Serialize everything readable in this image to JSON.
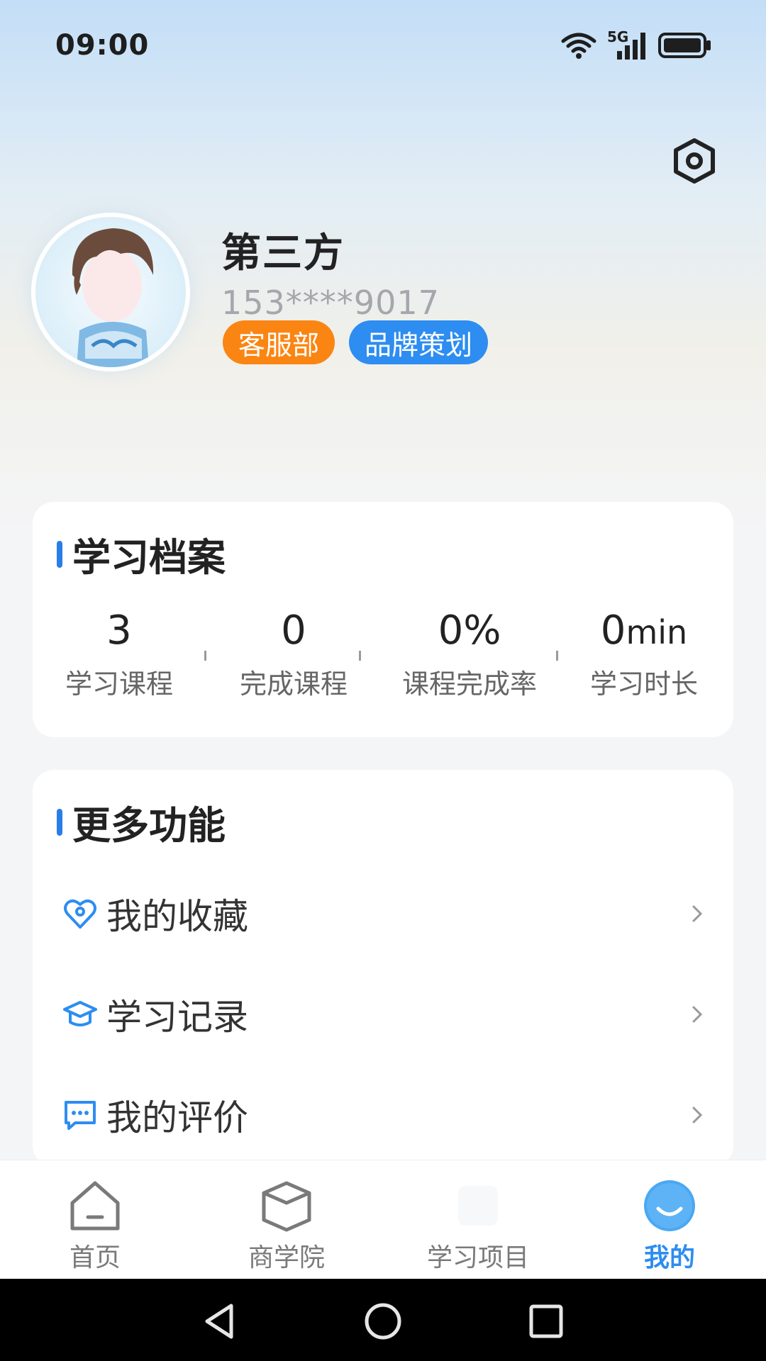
{
  "status_bar": {
    "time": "09:00",
    "network": "5G",
    "icons": [
      "wifi-icon",
      "signal-icon",
      "battery-icon"
    ]
  },
  "header": {
    "settings_icon": "settings-hex-icon"
  },
  "profile": {
    "name": "第三方",
    "phone": "153****9017",
    "tags": [
      {
        "label": "客服部",
        "color": "#fb8512"
      },
      {
        "label": "品牌策划",
        "color": "#2d8df1"
      }
    ]
  },
  "learning_profile": {
    "title": "学习档案",
    "stats": [
      {
        "value": "3",
        "unit": "",
        "label": "学习课程"
      },
      {
        "value": "0",
        "unit": "",
        "label": "完成课程"
      },
      {
        "value": "0%",
        "unit": "",
        "label": "课程完成率"
      },
      {
        "value": "0",
        "unit": "min",
        "label": "学习时长"
      }
    ]
  },
  "more_functions": {
    "title": "更多功能",
    "items": [
      {
        "label": "我的收藏",
        "icon": "heart-icon"
      },
      {
        "label": "学习记录",
        "icon": "graduation-cap-icon"
      },
      {
        "label": "我的评价",
        "icon": "comment-icon"
      }
    ]
  },
  "tabbar": {
    "tabs": [
      {
        "label": "首页",
        "icon": "home-icon",
        "active": false
      },
      {
        "label": "商学院",
        "icon": "academy-icon",
        "active": false
      },
      {
        "label": "学习项目",
        "icon": "project-icon",
        "active": false
      },
      {
        "label": "我的",
        "icon": "profile-smile-icon",
        "active": true
      }
    ]
  },
  "colors": {
    "accent": "#2d8df1",
    "accent_dark": "#2a7de9",
    "orange": "#fb8512"
  }
}
